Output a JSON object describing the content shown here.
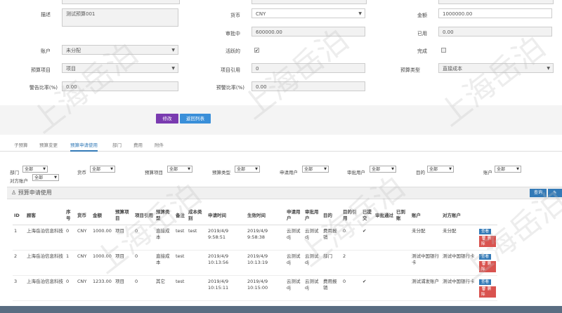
{
  "form": {
    "desc_label": "描述",
    "desc_value": "测试预算001",
    "currency_label": "货币",
    "currency_value": "CNY",
    "amount_label": "金额",
    "amount_value": "1000000.00",
    "approving_label": "审批中",
    "approving_value": "600000.00",
    "used_label": "已用",
    "used_value": "0.00",
    "account_label": "账户",
    "account_value": "未分配",
    "active_label": "活跃的",
    "active_check": "✔",
    "done_label": "完成",
    "item_label": "预算项目",
    "item_value": "项目",
    "item_ref_label": "项目引用",
    "item_ref_value": "0",
    "type_label": "预算类型",
    "type_value": "直接成本",
    "warn_label": "警告比率(%)",
    "warn_value": "0.00",
    "alert_label": "预警比率(%)",
    "alert_value": "0.00"
  },
  "buttons": {
    "edit": "修改",
    "back": "返回列表"
  },
  "tabs": [
    "子预算",
    "预算变更",
    "预算申请使用",
    "部门",
    "费用",
    "附件"
  ],
  "filters": [
    {
      "label": "部门",
      "value": "全部"
    },
    {
      "label": "货币",
      "value": "全部"
    },
    {
      "label": "预算项目",
      "value": "全部"
    },
    {
      "label": "预算类型",
      "value": "全部"
    },
    {
      "label": "申请用户",
      "value": "全部"
    },
    {
      "label": "审批用户",
      "value": "全部"
    },
    {
      "label": "目的",
      "value": "全部"
    },
    {
      "label": "账户",
      "value": "全部"
    },
    {
      "label": "对方账户",
      "value": "全部"
    }
  ],
  "section": {
    "title": "预算申请使用",
    "query": "查询",
    "edit_icon": "pencil-icon"
  },
  "table": {
    "headers": [
      "ID",
      "顾客",
      "序号",
      "货币",
      "金额",
      "预算项目",
      "项目引用",
      "预算类型",
      "备注",
      "成本类别",
      "申请时间",
      "生效时间",
      "申请用户",
      "审批用户",
      "目的",
      "目的引用",
      "已提交",
      "审批通过",
      "已到账",
      "账户",
      "对方账户"
    ],
    "rows": [
      [
        "1",
        "上海岳泊信息科技",
        "0",
        "CNY",
        "1000.00",
        "项目",
        "0",
        "直接成本",
        "test",
        "test",
        "2019/4/9 9:58:51",
        "2019/4/9 9:58:38",
        "云测试dj",
        "云测试dj",
        "费用报销",
        "0",
        "✔",
        "",
        "",
        "未分配",
        "未分配"
      ],
      [
        "2",
        "上海岳泊信息科技",
        "1",
        "CNY",
        "1000.00",
        "项目",
        "0",
        "直接成本",
        "test",
        "",
        "2019/4/9 10:13:56",
        "2019/4/9 10:13:19",
        "云测试dj",
        "云测试dj",
        "部门",
        "2",
        "",
        "",
        "",
        "测试中国银行卡",
        "测试中国银行卡"
      ],
      [
        "3",
        "上海岳泊信息科技",
        "0",
        "CNY",
        "1233.00",
        "项目",
        "0",
        "其它",
        "test",
        "",
        "2019/4/9 10:15:11",
        "2019/4/9 10:15:00",
        "云测试dj",
        "云测试dj",
        "费用报销",
        "0",
        "✔",
        "",
        "",
        "测试浦发账户",
        "测试中国银行卡"
      ]
    ],
    "view_label": "查看",
    "delete_label": "删除"
  },
  "watermark": "上海岳泊"
}
